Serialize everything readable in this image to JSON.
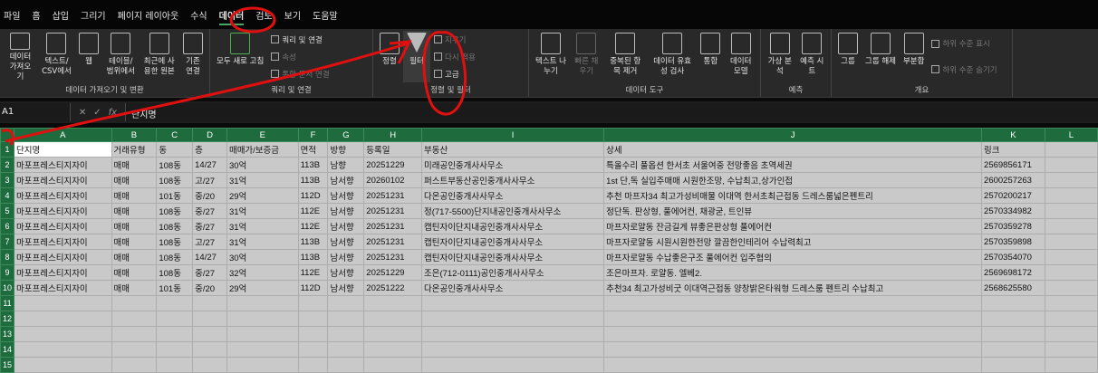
{
  "menu": [
    "파일",
    "홈",
    "삽입",
    "그리기",
    "페이지 레이아웃",
    "수식",
    "데이터",
    "검토",
    "보기",
    "도움말"
  ],
  "ribbon": {
    "get_data": {
      "label": "데이터 가져오기 및 변환",
      "buttons": [
        "데이터 가져오기",
        "텍스트/ CSV에서",
        "웹",
        "테이블/ 범위에서",
        "최근에 사용한 원본",
        "기존 연결"
      ]
    },
    "queries": {
      "label": "쿼리 및 연결",
      "refresh": "모두 새로 고침",
      "items": [
        "쿼리 및 연결",
        "속성",
        "통합 문서 연결"
      ]
    },
    "sort_filter": {
      "label": "정렬 및 필터",
      "sort": "정렬",
      "filter": "필터",
      "items": [
        "지우기",
        "다시 적용",
        "고급"
      ]
    },
    "data_tools": {
      "label": "데이터 도구",
      "buttons": [
        "텍스트 나누기",
        "빠른 채우기",
        "중복된 항목 제거",
        "데이터 유효성 검사",
        "통합",
        "데이터 모델"
      ]
    },
    "forecast": {
      "label": "예측",
      "buttons": [
        "가상 분석",
        "예측 시트"
      ]
    },
    "outline": {
      "label": "개요",
      "buttons": [
        "그룹",
        "그룹 해제",
        "부분합"
      ],
      "items": [
        "하위 수준 표시",
        "하위 수준 숨기기"
      ]
    }
  },
  "formula_bar": {
    "name_box": "A1",
    "cancel": "✕",
    "enter": "✓",
    "fx": "fx",
    "value": "단지명"
  },
  "sheet": {
    "columns": [
      "A",
      "B",
      "C",
      "D",
      "E",
      "F",
      "G",
      "H",
      "I",
      "J",
      "K",
      "L"
    ],
    "rows": [
      [
        "단지명",
        "거래유형",
        "동",
        "층",
        "매매가/보증금",
        "면적",
        "방향",
        "등록일",
        "부동산",
        "상세",
        "링크",
        ""
      ],
      [
        "마포프레스티지자이",
        "매매",
        "108동",
        "14/27",
        "30억",
        "113B",
        "남향",
        "20251229",
        "미래공인중개사사무소",
        "특올수리 풀옵션 한서초 서울여중 전망좋음 초역세권",
        "2569856171",
        ""
      ],
      [
        "마포프레스티지자이",
        "매매",
        "108동",
        "고/27",
        "31억",
        "113B",
        "남서향",
        "20260102",
        "퍼스트부동산공인중개사사무소",
        "1st 단,독 실입주매매 시원한조망, 수납최고,상가인접",
        "2600257263",
        ""
      ],
      [
        "마포프레스티지자이",
        "매매",
        "101동",
        "중/20",
        "29억",
        "112D",
        "남서향",
        "20251231",
        "다온공인중개사사무소",
        "추천 마프자34 최고가성비매물 이대역 한서초최근접동 드레스룸넓은펜트리",
        "2570200217",
        ""
      ],
      [
        "마포프레스티지자이",
        "매매",
        "108동",
        "중/27",
        "31억",
        "112E",
        "남서향",
        "20251231",
        "정(717-5500)단지내공인중개사사무소",
        "정단독. 판상형, 풀에어컨, 채광굳, 트인뷰",
        "2570334982",
        ""
      ],
      [
        "마포프레스티지자이",
        "매매",
        "108동",
        "중/27",
        "31억",
        "112E",
        "남서향",
        "20251231",
        "캡틴자이단지내공인중개사사무소",
        "마프자로얄동 잔금길게 뷰좋은판상형 풀에어컨",
        "2570359278",
        ""
      ],
      [
        "마포프레스티지자이",
        "매매",
        "108동",
        "고/27",
        "31억",
        "113B",
        "남서향",
        "20251231",
        "캡틴자이단지내공인중개사사무소",
        "마프자로얄동 시원시원한전망 깔끔한인테리어 수납력최고",
        "2570359898",
        ""
      ],
      [
        "마포프레스티지자이",
        "매매",
        "108동",
        "14/27",
        "30억",
        "113B",
        "남서향",
        "20251231",
        "캡틴자이단지내공인중개사사무소",
        "마프자로얄동 수납좋은구조 풀에어컨 입주협의",
        "2570354070",
        ""
      ],
      [
        "마포프레스티지자이",
        "매매",
        "108동",
        "중/27",
        "32억",
        "112E",
        "남서향",
        "20251229",
        "조은(712-0111)공인중개사사무소",
        "조은마프자. 로얄동. 엘베2.",
        "2569698172",
        ""
      ],
      [
        "마포프레스티지자이",
        "매매",
        "101동",
        "중/20",
        "29억",
        "112D",
        "남서향",
        "20251222",
        "다온공인중개사사무소",
        "추천34 최고가성비굿 이대역근접동 양창밝은타워형 드레스룸 펜트리 수납최고",
        "2568625580",
        ""
      ]
    ],
    "empty_rows": 5
  },
  "colors": {
    "header_green": "#1e6b3d",
    "annotation": "#e01010"
  }
}
